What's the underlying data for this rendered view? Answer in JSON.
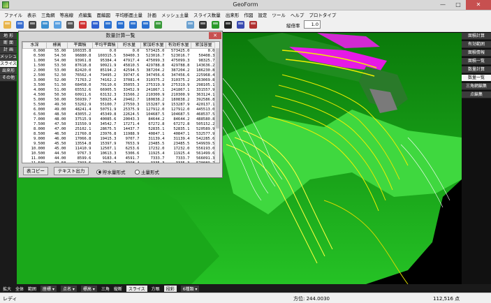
{
  "window": {
    "title": "GeoForm",
    "minimize": "—",
    "maximize": "□",
    "close": "✕"
  },
  "menu": [
    "ファイル",
    "表示",
    "三角網",
    "等高線",
    "点編集",
    "面編図",
    "平均断面土量",
    "計画",
    "メッシュ土量",
    "スライス数量",
    "出来形",
    "作図",
    "設定",
    "ツール",
    "ヘルプ",
    "プロトタイプ"
  ],
  "toolbar": {
    "icons": [
      "open-icon",
      "save-icon",
      "arrow-icon",
      "rotate-icon",
      "view-fit-icon",
      "layer-icon",
      "red-cube-icon",
      "blue-cube-icon",
      "arrow-up-icon",
      "arrow-down-icon",
      "arrow-left-icon",
      "arrow-right-icon",
      "terrain-icon",
      "chart-icon",
      "clear-icon",
      "tree-icon",
      "block-icon",
      "book-icon",
      "brush-icon"
    ],
    "exaggeration_label": "縦倍率",
    "exaggeration_value": "1.0"
  },
  "left_panel": [
    {
      "label": "地 形",
      "active": false
    },
    {
      "label": "断 面",
      "active": false
    },
    {
      "label": "計 画",
      "active": false
    },
    {
      "label": "メッシュ",
      "active": false
    },
    {
      "label": "スライス",
      "active": true
    },
    {
      "label": "出来形",
      "active": false
    },
    {
      "label": "その他",
      "active": false
    }
  ],
  "right_panel": [
    {
      "label": "面積計算",
      "active": false
    },
    {
      "label": "有効範囲",
      "active": false
    },
    {
      "label": "面積情報",
      "active": false
    },
    {
      "label": "面積一覧",
      "active": false
    },
    {
      "label": "数量計算",
      "active": false
    },
    {
      "label": "数量一覧",
      "active": true
    },
    {
      "label": "三角網編集",
      "active": false
    },
    {
      "label": "点編集",
      "active": false
    }
  ],
  "dialog": {
    "title": "数量計算一覧",
    "close": "✕",
    "columns": [
      "水深",
      "標高",
      "平面積",
      "平均平面積",
      "貯水量",
      "累加貯水量",
      "有効貯水量",
      "累加容量"
    ],
    "rows": [
      [
        "0.000",
        "55.00",
        "100335.8",
        "0.0",
        "0.0",
        "573425.0",
        "573425.0",
        "0.0"
      ],
      [
        "0.500",
        "54.50",
        "96880.8",
        "100315.5",
        "50400.3",
        "523016.7",
        "523016.7",
        "50408.3"
      ],
      [
        "1.000",
        "54.00",
        "93961.8",
        "95384.4",
        "47917.4",
        "475099.3",
        "475099.3",
        "98325.7"
      ],
      [
        "1.500",
        "53.50",
        "87618.8",
        "90921.9",
        "45810.5",
        "429788.8",
        "429788.8",
        "143636.2"
      ],
      [
        "2.000",
        "53.00",
        "82420.0",
        "85194.2",
        "42594.5",
        "387204.2",
        "387204.2",
        "186230.8"
      ],
      [
        "2.500",
        "52.50",
        "76562.4",
        "79495.2",
        "39747.6",
        "347456.6",
        "347456.6",
        "225968.4"
      ],
      [
        "3.000",
        "52.00",
        "71763.2",
        "74162.2",
        "37081.4",
        "310375.2",
        "310375.2",
        "263069.8"
      ],
      [
        "3.500",
        "51.50",
        "68458.0",
        "70110.6",
        "35055.3",
        "275319.9",
        "275319.9",
        "298105.1"
      ],
      [
        "4.000",
        "51.00",
        "65552.6",
        "66905.5",
        "33452.9",
        "241867.1",
        "241867.1",
        "331557.9"
      ],
      [
        "4.500",
        "50.50",
        "60911.6",
        "63132.3",
        "31566.2",
        "210300.9",
        "210300.9",
        "363124.1"
      ],
      [
        "5.000",
        "50.00",
        "56939.7",
        "58925.4",
        "29462.7",
        "180838.2",
        "180838.2",
        "392586.8"
      ],
      [
        "5.500",
        "49.50",
        "53262.9",
        "55100.7",
        "27550.3",
        "153287.9",
        "153287.9",
        "420137.1"
      ],
      [
        "6.000",
        "49.00",
        "48241.4",
        "50751.9",
        "25375.9",
        "127912.0",
        "127912.0",
        "445513.0"
      ],
      [
        "6.500",
        "48.50",
        "43055.2",
        "45349.8",
        "22624.5",
        "104687.5",
        "104687.5",
        "468537.5"
      ],
      [
        "7.000",
        "48.00",
        "37515.9",
        "40085.6",
        "20043.3",
        "84644.2",
        "84644.2",
        "488580.8"
      ],
      [
        "7.500",
        "47.50",
        "31550.9",
        "34542.7",
        "17271.4",
        "67272.8",
        "67272.8",
        "505152.2"
      ],
      [
        "8.000",
        "47.00",
        "25102.1",
        "28675.5",
        "14437.7",
        "52835.1",
        "52835.1",
        "520589.9"
      ],
      [
        "8.500",
        "46.50",
        "21760.8",
        "23976.8",
        "11988.9",
        "40847.1",
        "40847.1",
        "532577.9"
      ],
      [
        "9.000",
        "46.00",
        "17066.8",
        "19415.3",
        "9707.7",
        "31139.4",
        "31139.4",
        "542285.6"
      ],
      [
        "9.500",
        "45.50",
        "13554.8",
        "15397.9",
        "7653.9",
        "23485.5",
        "23485.5",
        "549939.5"
      ],
      [
        "10.000",
        "45.00",
        "11410.9",
        "12507.1",
        "6253.6",
        "17232.0",
        "17232.0",
        "556193.0"
      ],
      [
        "10.500",
        "44.50",
        "9767.3",
        "10613.3",
        "5306.6",
        "11925.4",
        "11925.4",
        "561499.6"
      ],
      [
        "11.000",
        "44.00",
        "8599.6",
        "9183.4",
        "4591.7",
        "7333.7",
        "7333.7",
        "566091.3"
      ],
      [
        "11.500",
        "43.50",
        "7393.5",
        "7996.7",
        "3998.4",
        "3335.3",
        "3335.3",
        "570089.7"
      ],
      [
        "12.000",
        "43.00",
        "6001.2",
        "6697.8",
        "3349.9",
        "0.0",
        "0.0",
        "573425.0"
      ]
    ],
    "copy_button": "表コピー",
    "text_button": "テキスト出力",
    "radio_storage": "貯水量形式",
    "radio_earth": "土量形式",
    "selected": "storage"
  },
  "bottom_bar": [
    {
      "text": "拡大",
      "style": "plain"
    },
    {
      "text": "全体",
      "style": "plain"
    },
    {
      "text": "範囲",
      "style": "plain"
    },
    {
      "text": "座標 ▾",
      "style": "dd"
    },
    {
      "text": "点名 ▾",
      "style": "dd"
    },
    {
      "text": "標高 ▾",
      "style": "dd"
    },
    {
      "text": "三角",
      "style": "plain"
    },
    {
      "text": "縦断",
      "style": "plain"
    },
    {
      "text": "スライス",
      "style": "hl"
    },
    {
      "text": "方眼",
      "style": "plain"
    },
    {
      "text": "段彩",
      "style": "hl"
    },
    {
      "text": "6種類 ▾",
      "style": "dd"
    }
  ],
  "status": {
    "ready": "レディ",
    "direction": "方位: 244.0030",
    "count": "112,516 点"
  }
}
